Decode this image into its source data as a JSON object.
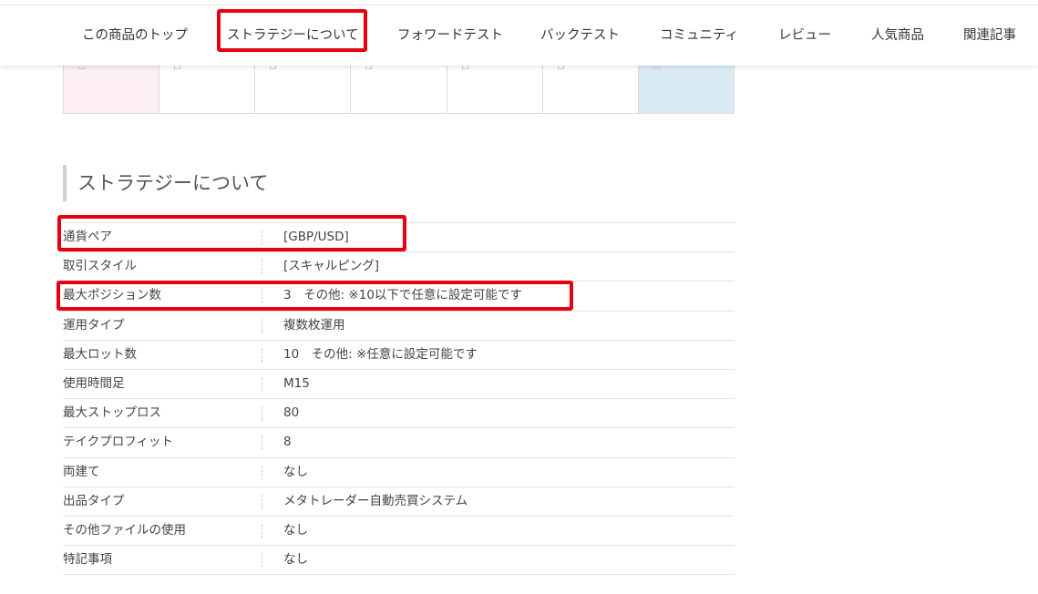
{
  "nav": {
    "items": [
      {
        "label": "この商品のトップ"
      },
      {
        "label": "ストラテジーについて"
      },
      {
        "label": "フォワードテスト"
      },
      {
        "label": "バックテスト"
      },
      {
        "label": "コミュニティ"
      },
      {
        "label": "レビュー"
      },
      {
        "label": "人気商品"
      },
      {
        "label": "関連記事"
      }
    ]
  },
  "section": {
    "title": "ストラテジーについて"
  },
  "specs": {
    "rows": [
      {
        "label": "通貨ペア",
        "value": "[GBP/USD]"
      },
      {
        "label": "取引スタイル",
        "value": "[スキャルピング]"
      },
      {
        "label": "最大ポジション数",
        "value": "3　その他: ※10以下で任意に設定可能です"
      },
      {
        "label": "運用タイプ",
        "value": "複数枚運用"
      },
      {
        "label": "最大ロット数",
        "value": "10　その他:  ※任意に設定可能です"
      },
      {
        "label": "使用時間足",
        "value": "M15"
      },
      {
        "label": "最大ストップロス",
        "value": "80"
      },
      {
        "label": "テイクプロフィット",
        "value": "8"
      },
      {
        "label": "両建て",
        "value": "なし"
      },
      {
        "label": "出品タイプ",
        "value": "メタトレーダー自動売買システム"
      },
      {
        "label": "その他ファイルの使用",
        "value": "なし"
      },
      {
        "label": "特記事項",
        "value": "なし"
      }
    ]
  },
  "colors": {
    "highlight": "#e60012",
    "tile_pink": "#fdeef3",
    "tile_blue": "#d8ebf5"
  }
}
